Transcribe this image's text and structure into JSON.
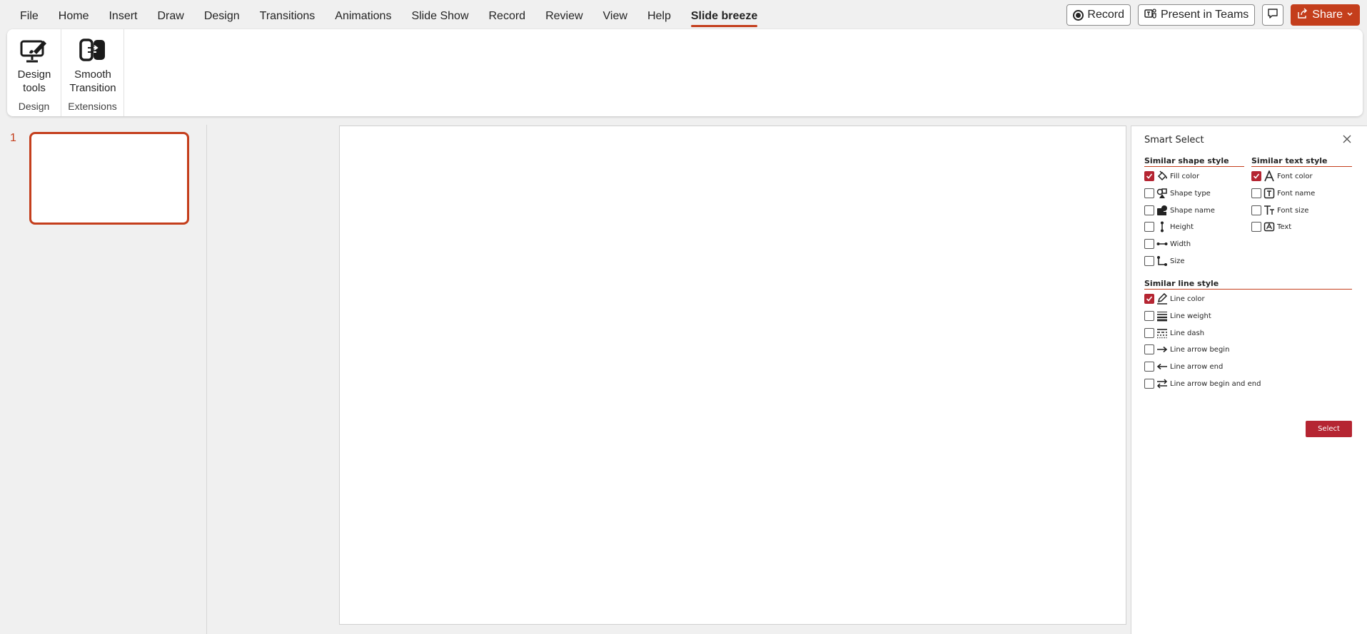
{
  "menu": {
    "tabs": [
      "File",
      "Home",
      "Insert",
      "Draw",
      "Design",
      "Transitions",
      "Animations",
      "Slide Show",
      "Record",
      "Review",
      "View",
      "Help",
      "Slide breeze"
    ],
    "active_tab": "Slide breeze"
  },
  "topright": {
    "record_label": "Record",
    "present_label": "Present in Teams",
    "share_label": "Share"
  },
  "ribbon": {
    "groups": [
      {
        "label": "Design",
        "buttons": [
          {
            "label_line1": "Design",
            "label_line2": "tools",
            "icon": "design-tools-icon"
          }
        ]
      },
      {
        "label": "Extensions",
        "buttons": [
          {
            "label_line1": "Smooth",
            "label_line2": "Transition",
            "icon": "smooth-transition-icon"
          }
        ]
      }
    ]
  },
  "thumbnails": {
    "slide_number": "1"
  },
  "smart_select": {
    "title": "Smart Select",
    "shape_section": "Similar shape style",
    "text_section": "Similar text style",
    "line_section": "Similar line style",
    "shape_options": [
      {
        "label": "Fill color",
        "checked": true
      },
      {
        "label": "Shape type",
        "checked": false
      },
      {
        "label": "Shape name",
        "checked": false
      },
      {
        "label": "Height",
        "checked": false
      },
      {
        "label": "Width",
        "checked": false
      },
      {
        "label": "Size",
        "checked": false
      }
    ],
    "text_options": [
      {
        "label": "Font color",
        "checked": true
      },
      {
        "label": "Font name",
        "checked": false
      },
      {
        "label": "Font size",
        "checked": false
      },
      {
        "label": "Text",
        "checked": false
      }
    ],
    "line_options": [
      {
        "label": "Line color",
        "checked": true
      },
      {
        "label": "Line weight",
        "checked": false
      },
      {
        "label": "Line dash",
        "checked": false
      },
      {
        "label": "Line arrow begin",
        "checked": false
      },
      {
        "label": "Line arrow end",
        "checked": false
      },
      {
        "label": "Line arrow begin and end",
        "checked": false
      }
    ],
    "select_label": "Select"
  },
  "colors": {
    "accent": "#c43e1c",
    "checkbox": "#b52532"
  }
}
